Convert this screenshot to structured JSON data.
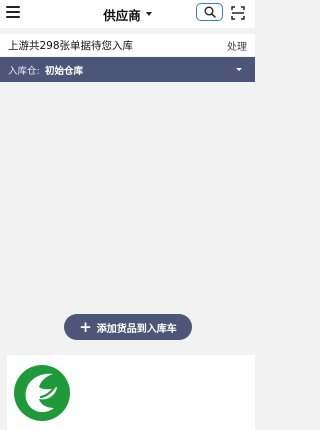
{
  "header": {
    "title": "供应商",
    "menu_icon": "menu-icon",
    "search_icon": "search-icon",
    "scan_icon": "scan-icon",
    "accent_color": "#2d7ed8"
  },
  "pending": {
    "text": "上游共298张单据待您入库",
    "action": "处理"
  },
  "warehouse": {
    "label": "入库仓:",
    "value": "初始仓库",
    "bar_color": "#4b5679"
  },
  "actions": {
    "add_to_cart": "添加货品到入库车",
    "add_icon": "plus-icon"
  },
  "brand": {
    "logo_icon": "logo-icon",
    "logo_color": "#1f9a3a"
  }
}
